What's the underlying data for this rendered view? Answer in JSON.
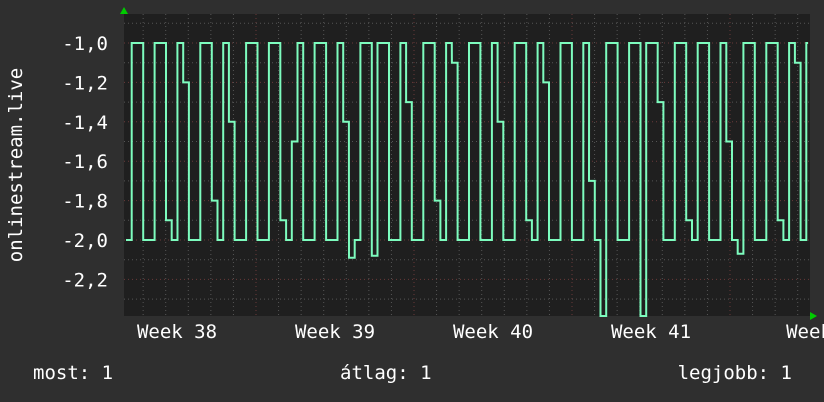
{
  "chart_data": {
    "type": "line",
    "ylabel": "onlinestream.live",
    "yticks": [
      "-1,0",
      "-1,2",
      "-1,4",
      "-1,6",
      "-1,8",
      "-2,0",
      "-2,2"
    ],
    "ytick_values": [
      -1.0,
      -1.2,
      -1.4,
      -1.6,
      -1.8,
      -2.0,
      -2.2
    ],
    "ylim": [
      -2.39,
      -0.85
    ],
    "xticks": [
      "Week 38",
      "Week 39",
      "Week 40",
      "Week 41",
      "Week"
    ],
    "grid": true,
    "line_color": "#7dfcbe",
    "series": [
      {
        "name": "onlinestream.live",
        "values": [
          -2,
          -1,
          -1,
          -2,
          -2,
          -1,
          -1,
          -1.9,
          -2,
          -1,
          -1.2,
          -2,
          -2,
          -1,
          -1,
          -1.8,
          -2,
          -1,
          -1.4,
          -2,
          -2,
          -1,
          -1,
          -2,
          -2,
          -1,
          -1,
          -1.9,
          -2,
          -1.5,
          -1,
          -2,
          -2,
          -1,
          -1,
          -2,
          -2,
          -1,
          -1.4,
          -2.09,
          -2,
          -1,
          -1,
          -2.08,
          -1,
          -1,
          -2,
          -2,
          -1,
          -1.3,
          -2,
          -2,
          -1,
          -1,
          -1.8,
          -2,
          -1,
          -1.1,
          -2,
          -2,
          -1,
          -1,
          -2,
          -2,
          -1,
          -1.4,
          -2,
          -2,
          -1,
          -1,
          -1.9,
          -2,
          -1,
          -1.2,
          -2,
          -2,
          -1,
          -1,
          -2,
          -2,
          -1,
          -1.7,
          -2,
          -2.4,
          -1,
          -1,
          -2,
          -2,
          -1,
          -1,
          -2.4,
          -1,
          -1,
          -1.3,
          -2,
          -2,
          -1,
          -1,
          -1.9,
          -2,
          -1,
          -1,
          -2,
          -2,
          -1,
          -1.5,
          -2,
          -2.07,
          -1,
          -1,
          -2,
          -2,
          -1,
          -1,
          -1.9,
          -2,
          -1,
          -1.1,
          -2,
          -1
        ]
      }
    ]
  },
  "legend": {
    "current": "most: 1",
    "average": "átlag: 1",
    "max": "legjobb: 1"
  }
}
